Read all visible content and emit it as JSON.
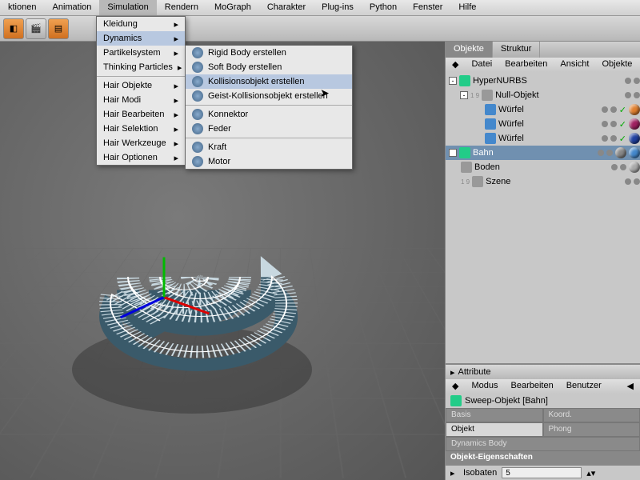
{
  "menubar": [
    "ktionen",
    "Animation",
    "Simulation",
    "Rendern",
    "MoGraph",
    "Charakter",
    "Plug-ins",
    "Python",
    "Fenster",
    "Hilfe"
  ],
  "menubar_active": 2,
  "sim_menu": [
    {
      "label": "Kleidung",
      "arrow": true
    },
    {
      "label": "Dynamics",
      "arrow": true,
      "hover": true
    },
    {
      "label": "Partikelsystem",
      "arrow": true
    },
    {
      "label": "Thinking Particles",
      "arrow": true
    },
    {
      "sep": true
    },
    {
      "label": "Hair Objekte",
      "arrow": true
    },
    {
      "label": "Hair Modi",
      "arrow": true
    },
    {
      "label": "Hair Bearbeiten",
      "arrow": true
    },
    {
      "label": "Hair Selektion",
      "arrow": true
    },
    {
      "label": "Hair Werkzeuge",
      "arrow": true
    },
    {
      "label": "Hair Optionen",
      "arrow": true
    }
  ],
  "dyn_menu": [
    {
      "label": "Rigid Body erstellen"
    },
    {
      "label": "Soft Body erstellen"
    },
    {
      "label": "Kollisionsobjekt erstellen",
      "hover": true
    },
    {
      "label": "Geist-Kollisionsobjekt erstellen"
    },
    {
      "sep": true
    },
    {
      "label": "Konnektor"
    },
    {
      "label": "Feder"
    },
    {
      "sep": true
    },
    {
      "label": "Kraft"
    },
    {
      "label": "Motor"
    }
  ],
  "right_tabs": [
    "Objekte",
    "Struktur"
  ],
  "right_tabs_active": 0,
  "panel_menu": [
    "Datei",
    "Bearbeiten",
    "Ansicht",
    "Objekte"
  ],
  "tree": [
    {
      "exp": "-",
      "icon": "green",
      "label": "HyperNURBS",
      "indent": 0
    },
    {
      "exp": "-",
      "icon": "gray",
      "label": "Null-Objekt",
      "indent": 1,
      "pre": "1 9"
    },
    {
      "icon": "blue",
      "label": "Würfel",
      "indent": 2,
      "vis": "green",
      "ball": "#e08030"
    },
    {
      "icon": "blue",
      "label": "Würfel",
      "indent": 2,
      "vis": "green",
      "ball": "#a02060"
    },
    {
      "icon": "blue",
      "label": "Würfel",
      "indent": 2,
      "vis": "green",
      "ball": "#2040a0"
    },
    {
      "exp": "+",
      "icon": "green",
      "label": "Bahn",
      "indent": 0,
      "sel": true,
      "ball": "#888",
      "extra": true
    },
    {
      "icon": "gray",
      "label": "Boden",
      "indent": 0,
      "ball": "#aaa"
    },
    {
      "pre": "1 9",
      "icon": "gray",
      "label": "Szene",
      "indent": 0
    }
  ],
  "attr": {
    "title": "Attribute",
    "menu": [
      "Modus",
      "Bearbeiten",
      "Benutzer"
    ],
    "obj_label": "Sweep-Objekt [Bahn]",
    "tabs": [
      "Basis",
      "Koord.",
      "Objekt",
      "Phong",
      "Dynamics Body"
    ],
    "tab_active": 2,
    "section": "Objekt-Eigenschaften",
    "isobaten_label": "Isobaten",
    "isobaten_value": "5"
  }
}
